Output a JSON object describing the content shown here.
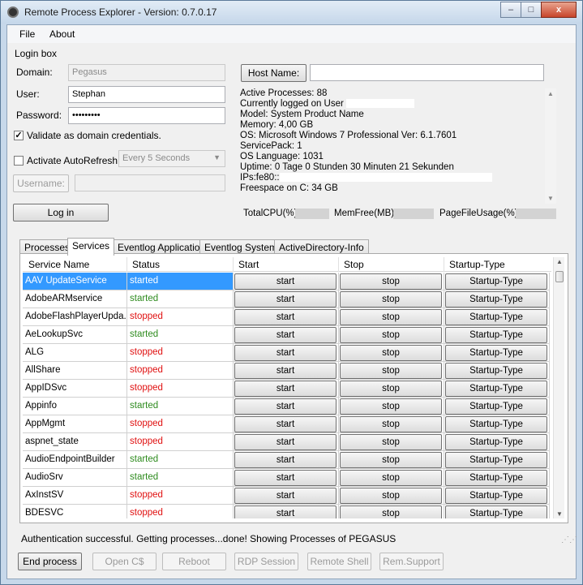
{
  "window": {
    "title": "Remote Process Explorer - Version: 0.7.0.17",
    "minimize": "–",
    "maximize": "□",
    "close": "x"
  },
  "menu": {
    "file": "File",
    "about": "About"
  },
  "login": {
    "group_label": "Login box",
    "domain_label": "Domain:",
    "domain_value": "Pegasus",
    "user_label": "User:",
    "user_value": "Stephan",
    "password_label": "Password:",
    "password_value": "•••••••••",
    "validate_label": "Validate as domain credentials.",
    "validate_checked": "✓",
    "autorefresh_label": "Activate AutoRefresh",
    "refresh_interval": "Every 5 Seconds",
    "username_button": "Username:",
    "login_button": "Log in"
  },
  "host": {
    "button_label": "Host Name:",
    "value": ""
  },
  "system_info": [
    "Active Processes: 88",
    "Currently logged on User",
    "Model: System Product Name",
    "Memory: 4,00 GB",
    "OS: Microsoft Windows 7 Professional  Ver: 6.1.7601",
    "ServicePack: 1",
    "OS Language: 1031",
    "Uptime: 0 Tage 0 Stunden 30 Minuten 21 Sekunden",
    "IPs:fe80::",
    "Freespace on C: 34 GB"
  ],
  "stats": {
    "total_cpu": "TotalCPU(%)",
    "mem_free": "MemFree(MB)",
    "pagefile": "PageFileUsage(%)"
  },
  "tabs": [
    "Processes",
    "Services",
    "Eventlog Application",
    "Eventlog System",
    "ActiveDirectory-Info"
  ],
  "grid": {
    "columns": [
      "Service Name",
      "Status",
      "Start",
      "Stop",
      "Startup-Type"
    ],
    "start_label": "start",
    "stop_label": "stop",
    "startup_label": "Startup-Type",
    "rows": [
      {
        "name": "AAV UpdateService",
        "status": "started"
      },
      {
        "name": "AdobeARMservice",
        "status": "started"
      },
      {
        "name": "AdobeFlashPlayerUpda...",
        "status": "stopped"
      },
      {
        "name": "AeLookupSvc",
        "status": "started"
      },
      {
        "name": "ALG",
        "status": "stopped"
      },
      {
        "name": "AllShare",
        "status": "stopped"
      },
      {
        "name": "AppIDSvc",
        "status": "stopped"
      },
      {
        "name": "Appinfo",
        "status": "started"
      },
      {
        "name": "AppMgmt",
        "status": "stopped"
      },
      {
        "name": "aspnet_state",
        "status": "stopped"
      },
      {
        "name": "AudioEndpointBuilder",
        "status": "started"
      },
      {
        "name": "AudioSrv",
        "status": "started"
      },
      {
        "name": "AxInstSV",
        "status": "stopped"
      },
      {
        "name": "BDESVC",
        "status": "stopped"
      }
    ]
  },
  "colors": {
    "started": "#2e8b1e",
    "stopped": "#e01010",
    "selection": "#3399ff"
  },
  "status_message": "Authentication successful. Getting processes...done! Showing Processes of PEGASUS",
  "buttons": {
    "end_process": "End process",
    "open_c": "Open C$",
    "reboot": "Reboot",
    "rdp": "RDP Session",
    "remote_shell": "Remote Shell",
    "rem_support": "Rem.Support"
  }
}
